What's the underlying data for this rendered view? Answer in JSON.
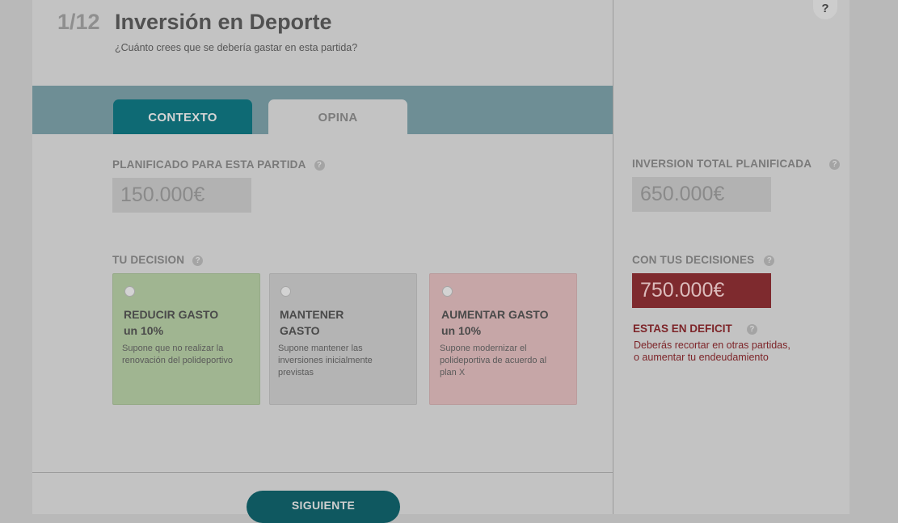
{
  "header": {
    "progress": "1/12",
    "title": "Inversión en Deporte",
    "subtitle": "¿Cuánto crees que se debería gastar en esta partida?",
    "help_label": "?"
  },
  "tabs": [
    {
      "label": "CONTEXTO",
      "active": true
    },
    {
      "label": "OPINA",
      "active": false
    }
  ],
  "planned": {
    "label": "PLANIFICADO PARA ESTA PARTIDA",
    "value": "150.000€"
  },
  "decision": {
    "label": "TU DECISION",
    "options": [
      {
        "title_line1": "REDUCIR GASTO",
        "title_line2": "un 10%",
        "description": "Supone que no realizar la renovación del polideportivo",
        "selected": false
      },
      {
        "title_line1": "MANTENER",
        "title_line2": "GASTO",
        "description": "Supone mantener las inversiones inicialmente previstas",
        "selected": false
      },
      {
        "title_line1": "AUMENTAR GASTO",
        "title_line2": "un 10%",
        "description": "Supone modernizar el polideportiva de acuerdo al plan X",
        "selected": false
      }
    ]
  },
  "summary": {
    "total_label": "INVERSION TOTAL PLANIFICADA",
    "total_value": "650.000€",
    "decisions_label": "CON TUS DECISIONES",
    "decisions_value": "750.000€",
    "deficit_title": "ESTAS EN DEFICIT",
    "deficit_message_line1": "Deberás recortar en otras partidas,",
    "deficit_message_line2": "o aumentar tu endeudamiento"
  },
  "footer": {
    "next_label": "SIGUIENTE"
  },
  "help_icon_glyph": "?",
  "colors": {
    "tab_active": "#0e6a74",
    "deficit": "#7e2a2e",
    "reduce": "#a0b591",
    "increase": "#c6a6a7",
    "next_button": "#0f5860"
  }
}
